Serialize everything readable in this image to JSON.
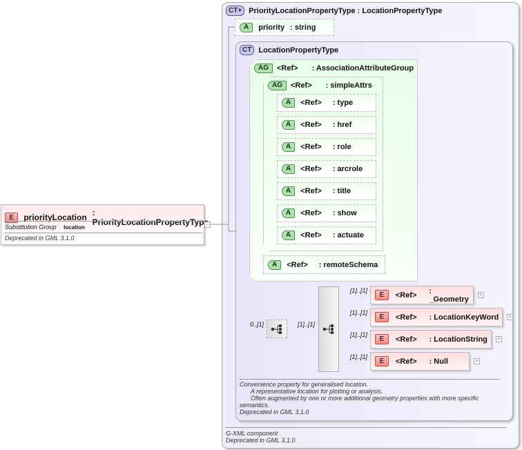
{
  "element": {
    "badge": "E",
    "name": "priorityLocation",
    "type": ": PriorityLocationPropertyType",
    "subst_label": "Substitution Group",
    "subst_value": "location",
    "doc": "Deprecated in GML 3.1.0",
    "collapse": "−"
  },
  "outer_type": {
    "badge": "CT+",
    "name": "PriorityLocationPropertyType : LocationPropertyType",
    "footer": [
      "G-XML component",
      "Deprecated in GML 3.1.0"
    ]
  },
  "priority_attr": {
    "badge": "A",
    "name": "priority",
    "type": ": string"
  },
  "inner_type": {
    "badge": "CT",
    "name": "LocationPropertyType",
    "doc": [
      "Convenience property for generalised location.",
      "A representative location for plotting or analysis.",
      "Often augmented by one or more additional geometry properties with more specific",
      "semantics.",
      "Deprecated in GML 3.1.0"
    ]
  },
  "association_group": {
    "badge": "AG",
    "ref": "<Ref>",
    "name": ": AssociationAttributeGroup"
  },
  "simple_attrs": {
    "badge": "AG",
    "ref": "<Ref>",
    "name": ": simpleAttrs",
    "items": [
      {
        "badge": "A",
        "ref": "<Ref>",
        "name": ": type"
      },
      {
        "badge": "A",
        "ref": "<Ref>",
        "name": ": href"
      },
      {
        "badge": "A",
        "ref": "<Ref>",
        "name": ": role"
      },
      {
        "badge": "A",
        "ref": "<Ref>",
        "name": ": arcrole"
      },
      {
        "badge": "A",
        "ref": "<Ref>",
        "name": ": title"
      },
      {
        "badge": "A",
        "ref": "<Ref>",
        "name": ": show"
      },
      {
        "badge": "A",
        "ref": "<Ref>",
        "name": ": actuate"
      }
    ]
  },
  "remote_schema": {
    "badge": "A",
    "ref": "<Ref>",
    "name": ": remoteSchema"
  },
  "choice": {
    "outer_mult": "0..[1]",
    "inner_mult": "[1]..[1]"
  },
  "choice_elements": [
    {
      "badge": "E",
      "ref": "<Ref>",
      "name": ": _Geometry",
      "mult": "[1]..[1]",
      "expand": "+"
    },
    {
      "badge": "E",
      "ref": "<Ref>",
      "name": ": LocationKeyWord",
      "mult": "[1]..[1]",
      "expand": "+"
    },
    {
      "badge": "E",
      "ref": "<Ref>",
      "name": ": LocationString",
      "mult": "[1]..[1]",
      "expand": "+"
    },
    {
      "badge": "E",
      "ref": "<Ref>",
      "name": ": Null",
      "mult": "[1]..[1]",
      "expand": "+"
    }
  ]
}
